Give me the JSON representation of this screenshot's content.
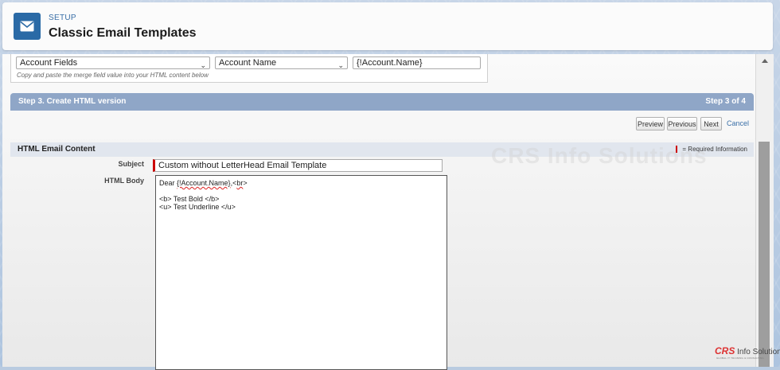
{
  "header": {
    "kicker": "SETUP",
    "title": "Classic Email Templates",
    "icon": "envelope-icon"
  },
  "merge_fields": {
    "field_type": "Account Fields",
    "field_name": "Account Name",
    "merge_value": "{!Account.Name}",
    "hint": "Copy and paste the merge field value into your HTML content below"
  },
  "step": {
    "title": "Step 3. Create HTML version",
    "count": "Step 3 of 4"
  },
  "buttons": {
    "preview": "Preview",
    "previous": "Previous",
    "next": "Next",
    "cancel": "Cancel"
  },
  "section": {
    "title": "HTML Email Content",
    "required_info": "= Required Information"
  },
  "form": {
    "subject_label": "Subject",
    "subject_value": "Custom without LetterHead Email Template",
    "body_label": "HTML Body",
    "body": {
      "line1_prefix": "Dear ",
      "line1_merge": "{!Account.Name}",
      "line1_mid": ",<",
      "line1_br": "br",
      "line1_end": ">",
      "line2": "",
      "line3": "<b> Test Bold </b>",
      "line4": "<u> Test Underline </u>"
    }
  },
  "watermark": "CRS Info Solutions",
  "logo": {
    "brand": "CRS",
    "rest": " Info Solutions",
    "tagline": "GLOBAL IT TRAINING & CONSULTING"
  },
  "colors": {
    "header_icon": "#2a6aa6",
    "step_bar": "#8fa6c7",
    "required": "#cc0000",
    "link": "#3a6fa7"
  }
}
